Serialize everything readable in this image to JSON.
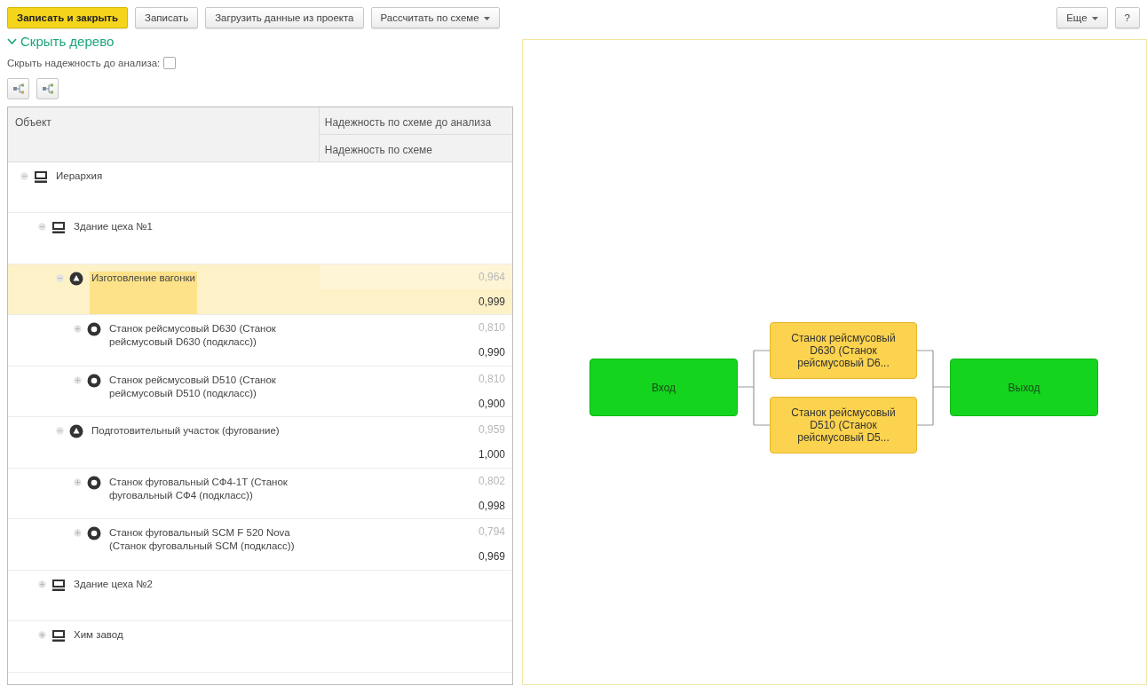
{
  "toolbar": {
    "buttons": [
      {
        "label": "Записать и закрыть",
        "kind": "primary"
      },
      {
        "label": "Записать",
        "kind": "plain"
      },
      {
        "label": "Загрузить данные из проекта",
        "kind": "plain"
      },
      {
        "label": "Рассчитать по схеме",
        "kind": "dropdown"
      }
    ],
    "right_buttons": [
      {
        "label": "Еще",
        "kind": "dropdown"
      },
      {
        "label": "?",
        "kind": "plain"
      }
    ]
  },
  "tree_toggle": {
    "label": "Скрыть дерево",
    "expanded": true
  },
  "hide_option": {
    "label": "Скрыть надежность до анализа:",
    "checked": false
  },
  "table": {
    "columns": [
      "Объект",
      "Надежность по схеме до анализа",
      "Надежность по схеме"
    ],
    "rows": [
      {
        "label": "Иерархия",
        "kind": "group",
        "expanded": true,
        "selected": false,
        "children": [
          {
            "label": "Здание цеха №1",
            "kind": "group",
            "expanded": true,
            "selected": false,
            "children": [
              {
                "label": "Изготовление вагонки",
                "kind": "process",
                "expanded": true,
                "selected": true,
                "value_before": "0,964",
                "value": "0,999",
                "children": [
                  {
                    "label": "Станок рейсмусовый D630 (Станок рейсмусовый D630 (подкласс))",
                    "kind": "machine",
                    "expanded": false,
                    "selected": false,
                    "value_before": "0,810",
                    "value": "0,990"
                  },
                  {
                    "label": "Станок рейсмусовый D510 (Станок рейсмусовый D510 (подкласс))",
                    "kind": "machine",
                    "expanded": false,
                    "selected": false,
                    "value_before": "0,810",
                    "value": "0,900"
                  }
                ]
              },
              {
                "label": "Подготовительный участок (фугование)",
                "kind": "process",
                "expanded": true,
                "selected": false,
                "value_before": "0,959",
                "value": "1,000",
                "children": [
                  {
                    "label": "Станок фуговальный СФ4-1Т (Станок фуговальный СФ4 (подкласс))",
                    "kind": "machine",
                    "expanded": false,
                    "selected": false,
                    "value_before": "0,802",
                    "value": "0,998"
                  },
                  {
                    "label": "Станок фуговальный SCM F 520 Nova (Станок фуговальный SCM (подкласс))",
                    "kind": "machine",
                    "expanded": false,
                    "selected": false,
                    "value_before": "0,794",
                    "value": "0,969"
                  }
                ]
              }
            ]
          },
          {
            "label": "Здание цеха №2",
            "kind": "group",
            "expanded": false,
            "selected": false
          },
          {
            "label": "Хим завод",
            "kind": "group",
            "expanded": false,
            "selected": false
          }
        ]
      }
    ]
  },
  "diagram": {
    "nodes": [
      {
        "label": "Вход",
        "kind": "terminal"
      },
      {
        "label": "Станок рейсмусовый D630 (Станок рейсмусовый D6...",
        "kind": "element"
      },
      {
        "label": "Станок рейсмусовый D510 (Станок рейсмусовый D5...",
        "kind": "element"
      },
      {
        "label": "Выход",
        "kind": "terminal"
      }
    ]
  }
}
